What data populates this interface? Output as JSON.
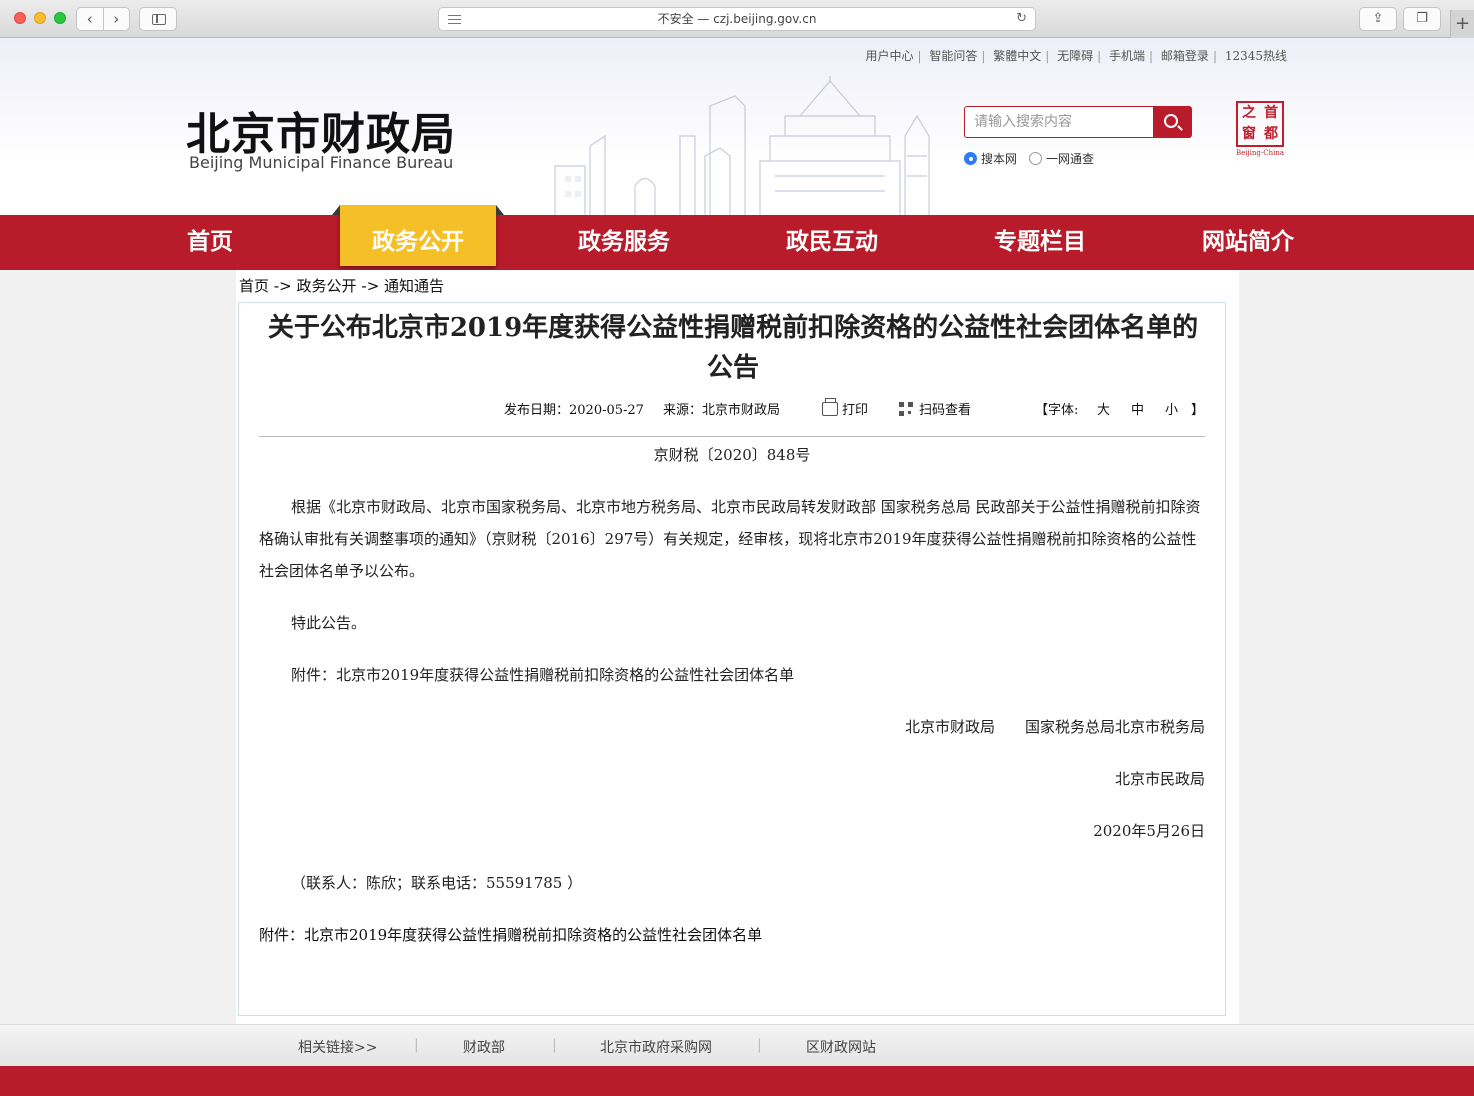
{
  "browser": {
    "url": "不安全 — czj.beijing.gov.cn"
  },
  "header": {
    "top_links": [
      "用户中心",
      "智能问答",
      "繁體中文",
      "无障碍",
      "手机端",
      "邮箱登录",
      "12345热线"
    ],
    "logo_cn": "北京市财政局",
    "logo_en": "Beijing Municipal Finance Bureau",
    "search_placeholder": "请输入搜索内容",
    "radio_options": [
      "搜本网",
      "一网通查"
    ],
    "radio_selected": "搜本网",
    "seal_chars": [
      "之",
      "首",
      "窗",
      "都"
    ],
    "seal_caption": "Beijing-China"
  },
  "nav": {
    "items": [
      "首页",
      "政务公开",
      "政务服务",
      "政民互动",
      "专题栏目",
      "网站简介"
    ],
    "active": "政务公开"
  },
  "breadcrumb": "首页 -> 政务公开 -> 通知通告",
  "article": {
    "title": "关于公布北京市2019年度获得公益性捐赠税前扣除资格的公益性社会团体名单的公告",
    "publish_date": "发布日期：2020-05-27",
    "source": "来源：北京市财政局",
    "print_label": "打印",
    "qr_label": "扫码查看",
    "font_label": "【字体:",
    "font_large": "大",
    "font_medium": "中",
    "font_small": "小",
    "font_close": "】",
    "doc_number": "京财税〔2020〕848号",
    "para1": "根据《北京市财政局、北京市国家税务局、北京市地方税务局、北京市民政局转发财政部 国家税务总局 民政部关于公益性捐赠税前扣除资格确认审批有关调整事项的通知》（京财税〔2016〕297号）有关规定，经审核，现将北京市2019年度获得公益性捐赠税前扣除资格的公益性社会团体名单予以公布。",
    "para2": "特此公告。",
    "para3": "附件：北京市2019年度获得公益性捐赠税前扣除资格的公益性社会团体名单",
    "signers1": "北京市财政局　　国家税务总局北京市税务局",
    "signers2": "北京市民政局",
    "sign_date": "2020年5月26日",
    "contact": "（联系人：陈欣；联系电话：55591785 ）",
    "attachment_link": "附件：北京市2019年度获得公益性捐赠税前扣除资格的公益性社会团体名单"
  },
  "footer": {
    "related": "相关链接>>",
    "links": [
      "财政部",
      "北京市政府采购网",
      "区财政网站"
    ]
  },
  "colors": {
    "brand_red": "#b81c2a",
    "nav_active": "#f5c027"
  }
}
